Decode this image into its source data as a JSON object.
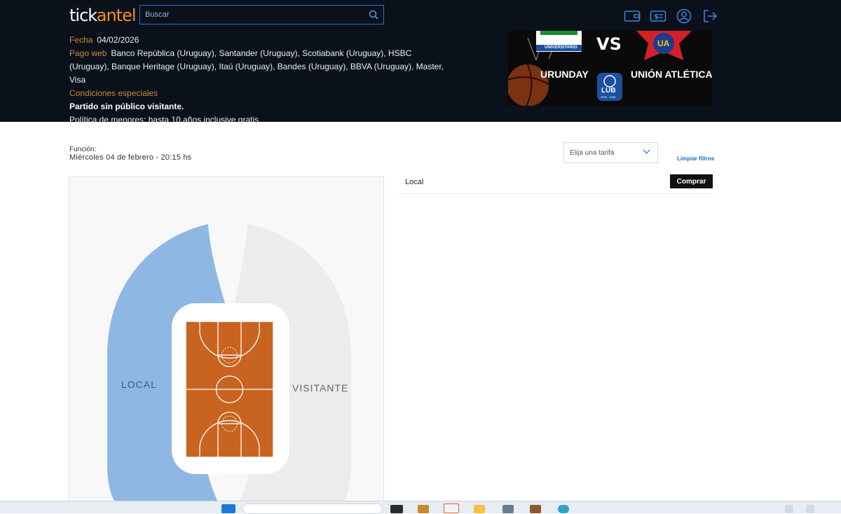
{
  "header": {
    "logo_left": "tick",
    "logo_right": "antel",
    "search_placeholder": "Buscar",
    "icons": [
      "wallet-icon",
      "ticket-money-icon",
      "user-icon",
      "logout-icon"
    ]
  },
  "event": {
    "fecha_label": "Fecha",
    "fecha_value": "04/02/2026",
    "pago_label": "Pago web",
    "pago_value": "Banco República (Uruguay),  Santander (Uruguay),  Scotiabank (Uruguay),  HSBC (Uruguay),  Banque Heritage (Uruguay),  Itaú (Uruguay),  Bandes (Uruguay),  BBVA (Uruguay),  Master,  Visa",
    "condiciones_label": "Condiciones especiales",
    "condicion_1": "Partido sin público visitante.",
    "condicion_2": "Política de menores: hasta 10 años inclusive gratis."
  },
  "banner": {
    "vs": "VS",
    "team1": "URUNDAY",
    "team2": "UNIÓN ATLÉTICA",
    "team1_badge": "UNIVERSITARIO",
    "team2_badge": "UA",
    "league": "LUB",
    "season": "2025 - 2026"
  },
  "funcion": {
    "label": "Función:",
    "date": "Miércoles 04 de febrero - 20:15 hs"
  },
  "filters": {
    "tarifa_placeholder": "Elija una tarifa",
    "clear_label": "Limpiar filtros"
  },
  "map": {
    "local_label": "LOCAL",
    "visitante_label": "VISITANTE",
    "local_color": "#8fb7e3",
    "visitante_color": "#ececec",
    "court_color": "#c8641f"
  },
  "sectors": [
    {
      "name": "Local",
      "button": "Comprar"
    }
  ]
}
